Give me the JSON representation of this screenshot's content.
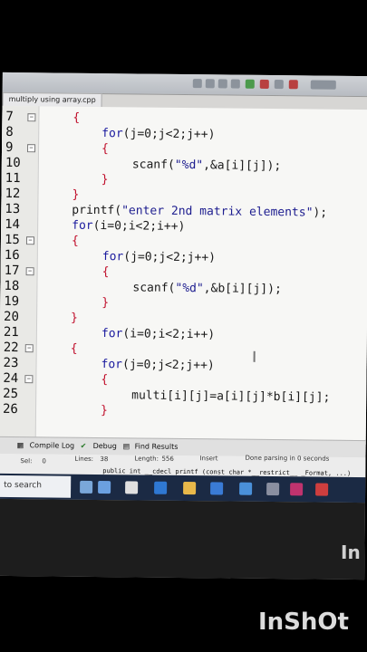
{
  "tab": {
    "label": "multiply using array.cpp"
  },
  "code_lines": [
    {
      "num": "7",
      "indent": 78,
      "fold": "−",
      "parts": [
        {
          "t": "{",
          "c": "br"
        }
      ]
    },
    {
      "num": "8",
      "indent": 110,
      "fold": "",
      "parts": [
        {
          "t": "for",
          "c": "kw"
        },
        {
          "t": "(j=0;j<2;j++)",
          "c": "pl"
        }
      ]
    },
    {
      "num": "9",
      "indent": 110,
      "fold": "−",
      "parts": [
        {
          "t": "{",
          "c": "br"
        }
      ]
    },
    {
      "num": "10",
      "indent": 144,
      "fold": "",
      "parts": [
        {
          "t": "scanf(",
          "c": "pl"
        },
        {
          "t": "\"%d\"",
          "c": "st"
        },
        {
          "t": ",&a[i][j]);",
          "c": "pl"
        }
      ]
    },
    {
      "num": "11",
      "indent": 110,
      "fold": "",
      "parts": [
        {
          "t": "}",
          "c": "br"
        }
      ]
    },
    {
      "num": "12",
      "indent": 78,
      "fold": "",
      "parts": [
        {
          "t": "}",
          "c": "br"
        }
      ]
    },
    {
      "num": "13",
      "indent": 78,
      "fold": "",
      "parts": [
        {
          "t": "printf(",
          "c": "pl"
        },
        {
          "t": "\"enter 2nd matrix elements\"",
          "c": "st"
        },
        {
          "t": ");",
          "c": "pl"
        }
      ]
    },
    {
      "num": "14",
      "indent": 78,
      "fold": "",
      "parts": [
        {
          "t": "for",
          "c": "kw"
        },
        {
          "t": "(i=0;i<2;i++)",
          "c": "pl"
        }
      ]
    },
    {
      "num": "15",
      "indent": 78,
      "fold": "−",
      "parts": [
        {
          "t": "{",
          "c": "br"
        }
      ]
    },
    {
      "num": "16",
      "indent": 112,
      "fold": "",
      "parts": [
        {
          "t": "for",
          "c": "kw"
        },
        {
          "t": "(j=0;j<2;j++)",
          "c": "pl"
        }
      ]
    },
    {
      "num": "17",
      "indent": 112,
      "fold": "−",
      "parts": [
        {
          "t": "{",
          "c": "br"
        }
      ]
    },
    {
      "num": "18",
      "indent": 146,
      "fold": "",
      "parts": [
        {
          "t": "scanf(",
          "c": "pl"
        },
        {
          "t": "\"%d\"",
          "c": "st"
        },
        {
          "t": ",&b[i][j]);",
          "c": "pl"
        }
      ]
    },
    {
      "num": "19",
      "indent": 112,
      "fold": "",
      "parts": [
        {
          "t": "}",
          "c": "br"
        }
      ]
    },
    {
      "num": "20",
      "indent": 78,
      "fold": "",
      "parts": [
        {
          "t": "}",
          "c": "br"
        }
      ]
    },
    {
      "num": "21",
      "indent": 112,
      "fold": "",
      "parts": [
        {
          "t": "for",
          "c": "kw"
        },
        {
          "t": "(i=0;i<2;i++)",
          "c": "pl"
        }
      ]
    },
    {
      "num": "22",
      "indent": 78,
      "fold": "−",
      "parts": [
        {
          "t": "{",
          "c": "br"
        }
      ]
    },
    {
      "num": "23",
      "indent": 112,
      "fold": "",
      "parts": [
        {
          "t": "for",
          "c": "kw"
        },
        {
          "t": "(j=0;j<2;j++)",
          "c": "pl"
        }
      ]
    },
    {
      "num": "24",
      "indent": 112,
      "fold": "−",
      "parts": [
        {
          "t": "{",
          "c": "br"
        }
      ]
    },
    {
      "num": "25",
      "indent": 146,
      "fold": "",
      "parts": [
        {
          "t": "multi[i][j]=a[i][j]*b[i][j];",
          "c": "pl"
        }
      ]
    },
    {
      "num": "26",
      "indent": 112,
      "fold": "",
      "parts": [
        {
          "t": "}",
          "c": "br"
        }
      ]
    }
  ],
  "bottom_tabs": {
    "compile_log": "Compile Log",
    "debug": "Debug",
    "find_results": "Find Results"
  },
  "status": {
    "sel_label": "Sel:",
    "sel_value": "0",
    "lines_label": "Lines:",
    "lines_value": "38",
    "length_label": "Length:",
    "length_value": "556",
    "mode": "Insert",
    "message": "Done parsing in 0 seconds",
    "hint": "public int __cdecl printf (const char *__restrict__ _Format, ...)"
  },
  "taskbar": {
    "search_placeholder": "to search"
  },
  "watermarks": {
    "side": "In",
    "main": "InShOt"
  },
  "colors": {
    "keyword": "#1a1a9e",
    "brace": "#c0102c",
    "string": "#1d1d8f",
    "taskbar": "#1b2a44"
  }
}
